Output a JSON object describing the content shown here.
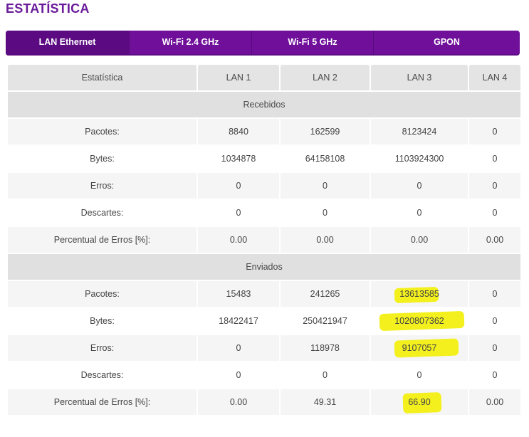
{
  "page": {
    "title": "ESTATÍSTICA"
  },
  "tabs": [
    {
      "label": "LAN Ethernet",
      "active": true
    },
    {
      "label": "Wi-Fi 2.4 GHz",
      "active": false
    },
    {
      "label": "Wi-Fi 5 GHz",
      "active": false
    },
    {
      "label": "GPON",
      "active": false
    }
  ],
  "table": {
    "headers": [
      "Estatística",
      "LAN 1",
      "LAN 2",
      "LAN 3",
      "LAN 4"
    ],
    "received": {
      "title": "Recebidos",
      "rows": [
        {
          "label": "Pacotes:",
          "values": [
            "8840",
            "162599",
            "8123424",
            "0"
          ]
        },
        {
          "label": "Bytes:",
          "values": [
            "1034878",
            "64158108",
            "1103924300",
            "0"
          ]
        },
        {
          "label": "Erros:",
          "values": [
            "0",
            "0",
            "0",
            "0"
          ]
        },
        {
          "label": "Descartes:",
          "values": [
            "0",
            "0",
            "0",
            "0"
          ]
        },
        {
          "label": "Percentual de Erros [%]:",
          "values": [
            "0.00",
            "0.00",
            "0.00",
            "0.00"
          ]
        }
      ]
    },
    "sent": {
      "title": "Enviados",
      "rows": [
        {
          "label": "Pacotes:",
          "values": [
            "15483",
            "241265",
            "13613585",
            "0"
          ]
        },
        {
          "label": "Bytes:",
          "values": [
            "18422417",
            "250421947",
            "1020807362",
            "0"
          ]
        },
        {
          "label": "Erros:",
          "values": [
            "0",
            "118978",
            "9107057",
            "0"
          ]
        },
        {
          "label": "Descartes:",
          "values": [
            "0",
            "0",
            "0",
            "0"
          ]
        },
        {
          "label": "Percentual de Erros [%]:",
          "values": [
            "0.00",
            "49.31",
            "66.90",
            "0.00"
          ]
        }
      ]
    }
  },
  "colors": {
    "accent": "#6f0f9a",
    "title": "#6a1b9a",
    "highlighter": "#f3f01e"
  }
}
